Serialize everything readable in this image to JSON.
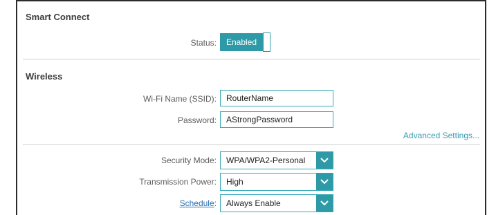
{
  "smart_connect": {
    "title": "Smart Connect",
    "status_label": "Status:",
    "status_value": "Enabled"
  },
  "wireless": {
    "title": "Wireless",
    "ssid_label": "Wi-Fi Name (SSID):",
    "ssid_value": "RouterName",
    "password_label": "Password:",
    "password_value": "AStrongPassword",
    "advanced_link": "Advanced Settings...",
    "security_label": "Security Mode:",
    "security_value": "WPA/WPA2-Personal",
    "power_label": "Transmission Power:",
    "power_value": "High",
    "schedule_label": "Schedule",
    "schedule_value": "Always Enable"
  },
  "colors": {
    "accent": "#2e9aa8",
    "link": "#3a9db0"
  }
}
